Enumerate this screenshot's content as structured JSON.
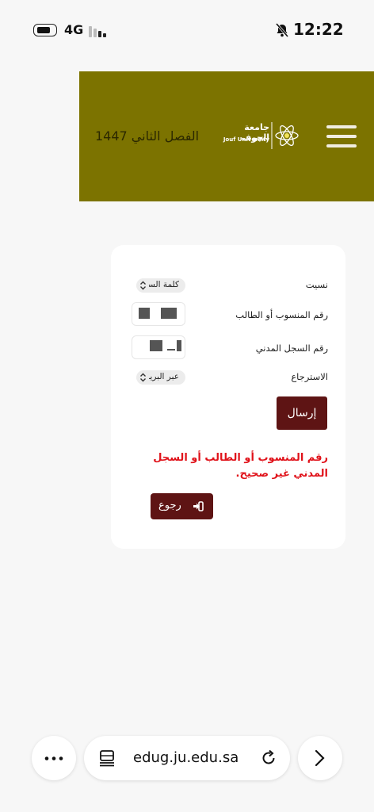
{
  "status_bar": {
    "network": "4G",
    "time": "12:22"
  },
  "header": {
    "term_label": "الفصل الثاني 1447",
    "logo_arabic": "جامعة الجوف",
    "logo_english": "Jouf University",
    "brand_color": "#7c7300"
  },
  "form": {
    "forgot_label": "نسيت",
    "forgot_value": "كلمة السر",
    "id_label": "رقم المنسوب أو الطالب",
    "civil_label": "رقم السجل المدني",
    "recovery_label": "الاسترجاع",
    "recovery_value": "عبر البريد",
    "submit_label": "إرسال",
    "error_message": "رقم المنسوب أو الطالب أو السجل المدني غير صحيح.",
    "back_label": "رجوع",
    "button_color": "#5e1414",
    "error_color": "#e0121a"
  },
  "browser": {
    "url": "edug.ju.edu.sa"
  }
}
